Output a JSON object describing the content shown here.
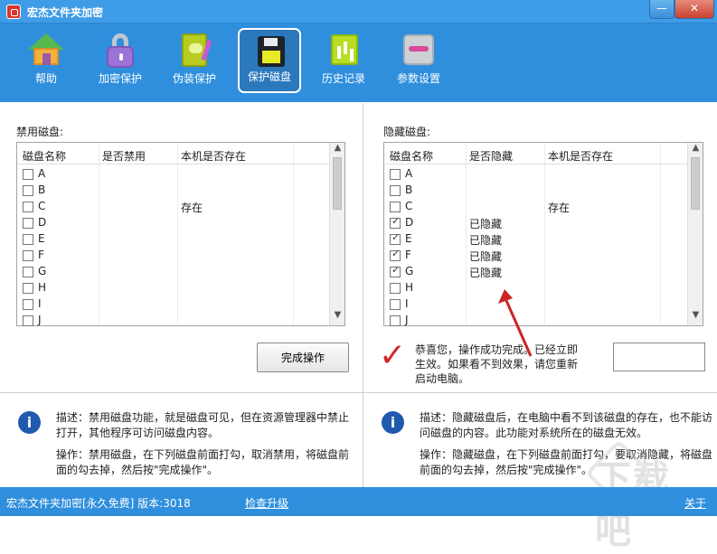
{
  "window": {
    "title": "宏杰文件夹加密",
    "minimize": "—",
    "close": "✕"
  },
  "toolbar": [
    {
      "label": "帮助",
      "icon": "home-icon"
    },
    {
      "label": "加密保护",
      "icon": "lock-icon"
    },
    {
      "label": "伪装保护",
      "icon": "book-icon"
    },
    {
      "label": "保护磁盘",
      "icon": "floppy-disk-icon",
      "active": true
    },
    {
      "label": "历史记录",
      "icon": "history-chart-icon"
    },
    {
      "label": "参数设置",
      "icon": "settings-tools-icon"
    }
  ],
  "left": {
    "label": "禁用磁盘:",
    "columns": [
      "磁盘名称",
      "是否禁用",
      "本机是否存在"
    ],
    "rows": [
      {
        "drive": "A",
        "status": "",
        "exists": "",
        "checked": false
      },
      {
        "drive": "B",
        "status": "",
        "exists": "",
        "checked": false
      },
      {
        "drive": "C",
        "status": "",
        "exists": "存在",
        "checked": false
      },
      {
        "drive": "D",
        "status": "",
        "exists": "",
        "checked": false
      },
      {
        "drive": "E",
        "status": "",
        "exists": "",
        "checked": false
      },
      {
        "drive": "F",
        "status": "",
        "exists": "",
        "checked": false
      },
      {
        "drive": "G",
        "status": "",
        "exists": "",
        "checked": false
      },
      {
        "drive": "H",
        "status": "",
        "exists": "",
        "checked": false
      },
      {
        "drive": "I",
        "status": "",
        "exists": "",
        "checked": false
      },
      {
        "drive": "J",
        "status": "",
        "exists": "",
        "checked": false
      }
    ],
    "finish_button": "完成操作",
    "description": "描述：禁用磁盘功能，就是磁盘可见，但在资源管理器中禁止打开，其他程序可访问磁盘内容。",
    "operation": "操作：禁用磁盘，在下列磁盘前面打勾，取消禁用，将磁盘前面的勾去掉，然后按\"完成操作\"。"
  },
  "right": {
    "label": "隐藏磁盘:",
    "columns": [
      "磁盘名称",
      "是否隐藏",
      "本机是否存在"
    ],
    "rows": [
      {
        "drive": "A",
        "status": "",
        "exists": "",
        "checked": false
      },
      {
        "drive": "B",
        "status": "",
        "exists": "",
        "checked": false
      },
      {
        "drive": "C",
        "status": "",
        "exists": "存在",
        "checked": false
      },
      {
        "drive": "D",
        "status": "已隐藏",
        "exists": "",
        "checked": true
      },
      {
        "drive": "E",
        "status": "已隐藏",
        "exists": "",
        "checked": true
      },
      {
        "drive": "F",
        "status": "已隐藏",
        "exists": "",
        "checked": true
      },
      {
        "drive": "G",
        "status": "已隐藏",
        "exists": "",
        "checked": true
      },
      {
        "drive": "H",
        "status": "",
        "exists": "",
        "checked": false
      },
      {
        "drive": "I",
        "status": "",
        "exists": "",
        "checked": false
      },
      {
        "drive": "J",
        "status": "",
        "exists": "",
        "checked": false
      }
    ],
    "success": "恭喜您，操作成功完成。已经立即生效。如果看不到效果，请您重新启动电脑。",
    "description": "描述：隐藏磁盘后，在电脑中看不到该磁盘的存在，也不能访问磁盘的内容。此功能对系统所在的磁盘无效。",
    "operation": "操作：隐藏磁盘，在下列磁盘前面打勾，要取消隐藏，将磁盘前面的勾去掉，然后按\"完成操作\"。"
  },
  "status": {
    "left": "宏杰文件夹加密[永久免费]  版本:3018",
    "check_update": "检查升级",
    "about": "关于"
  },
  "colors": {
    "accent": "#2f8fdd",
    "success_mark": "#d22a21",
    "arrow": "#cc2424"
  }
}
